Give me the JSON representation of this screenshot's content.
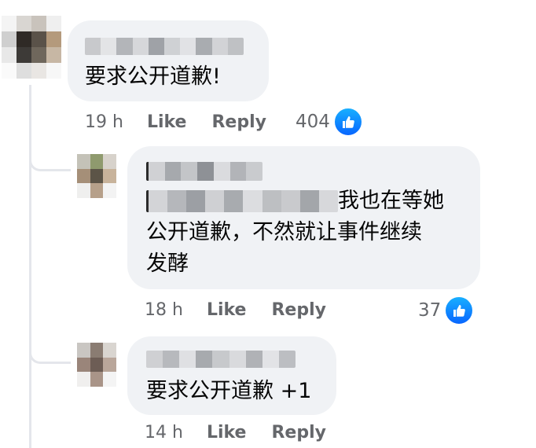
{
  "comments": [
    {
      "text": "要求公开道歉!",
      "time": "19 h",
      "like_label": "Like",
      "reply_label": "Reply",
      "reaction_count": "404",
      "reaction_icon": "thumbs-up-icon"
    },
    {
      "text_suffix": "我也在等她",
      "text_rest": "公开道歉，不然就让事件继续\n发酵",
      "time": "18 h",
      "like_label": "Like",
      "reply_label": "Reply",
      "reaction_count": "37",
      "reaction_icon": "thumbs-up-icon"
    },
    {
      "text": "要求公开道歉 +1",
      "time": "14 h",
      "like_label": "Like",
      "reply_label": "Reply"
    }
  ],
  "colors": {
    "bubble": "#f0f2f5",
    "meta_text": "#65676b",
    "like_blue": "#0866ff",
    "thread_line": "#e4e6eb"
  }
}
